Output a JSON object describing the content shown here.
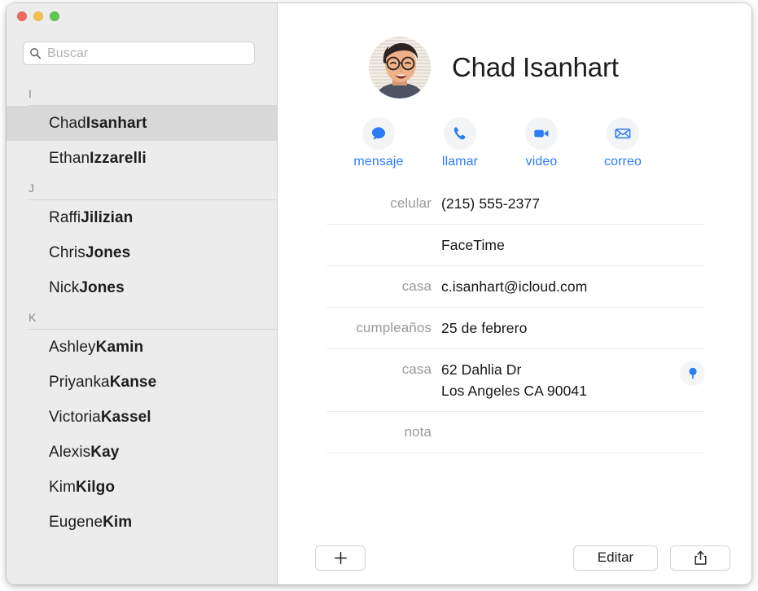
{
  "window": {
    "traffic_lights": [
      {
        "name": "close",
        "color": "#ec6a5f"
      },
      {
        "name": "minimize",
        "color": "#f4bf50"
      },
      {
        "name": "zoom",
        "color": "#61c554"
      }
    ],
    "accent_color": "#2b7cf6"
  },
  "search": {
    "placeholder": "Buscar",
    "value": "",
    "icon": "search-icon"
  },
  "sidebar": {
    "sections": [
      {
        "letter": "I",
        "contacts": [
          {
            "first": "Chad",
            "last": "Isanhart",
            "selected": true
          },
          {
            "first": "Ethan",
            "last": "Izzarelli",
            "selected": false
          }
        ]
      },
      {
        "letter": "J",
        "contacts": [
          {
            "first": "Raffi",
            "last": "Jilizian",
            "selected": false
          },
          {
            "first": "Chris",
            "last": "Jones",
            "selected": false
          },
          {
            "first": "Nick",
            "last": "Jones",
            "selected": false
          }
        ]
      },
      {
        "letter": "K",
        "contacts": [
          {
            "first": "Ashley",
            "last": "Kamin",
            "selected": false
          },
          {
            "first": "Priyanka",
            "last": "Kanse",
            "selected": false
          },
          {
            "first": "Victoria",
            "last": "Kassel",
            "selected": false
          },
          {
            "first": "Alexis",
            "last": "Kay",
            "selected": false
          },
          {
            "first": "Kim",
            "last": "Kilgo",
            "selected": false
          },
          {
            "first": "Eugene",
            "last": "Kim",
            "selected": false
          }
        ]
      }
    ]
  },
  "contact": {
    "name": "Chad Isanhart",
    "avatar": "contact-photo",
    "actions": [
      {
        "label": "mensaje",
        "icon": "message-bubble-icon"
      },
      {
        "label": "llamar",
        "icon": "phone-icon"
      },
      {
        "label": "video",
        "icon": "video-camera-icon"
      },
      {
        "label": "correo",
        "icon": "envelope-icon"
      }
    ],
    "fields": [
      {
        "label": "celular",
        "value": "(215) 555-2377",
        "lines": [
          "(215) 555-2377"
        ]
      },
      {
        "label": "",
        "value": "FaceTime",
        "lines": [
          "FaceTime"
        ]
      },
      {
        "label": "casa",
        "value": "c.isanhart@icloud.com",
        "lines": [
          "c.isanhart@icloud.com"
        ]
      },
      {
        "label": "cumpleaños",
        "value": "25 de febrero",
        "lines": [
          "25 de febrero"
        ]
      },
      {
        "label": "casa",
        "value": "62 Dahlia Dr Los Angeles CA 90041",
        "lines": [
          "62 Dahlia Dr",
          "Los Angeles CA 90041"
        ],
        "has_map_pin": true
      },
      {
        "label": "nota",
        "value": "",
        "lines": [
          ""
        ]
      }
    ]
  },
  "toolbar": {
    "add_label": "+",
    "add_icon": "plus-icon",
    "edit_label": "Editar",
    "share_icon": "share-icon"
  }
}
